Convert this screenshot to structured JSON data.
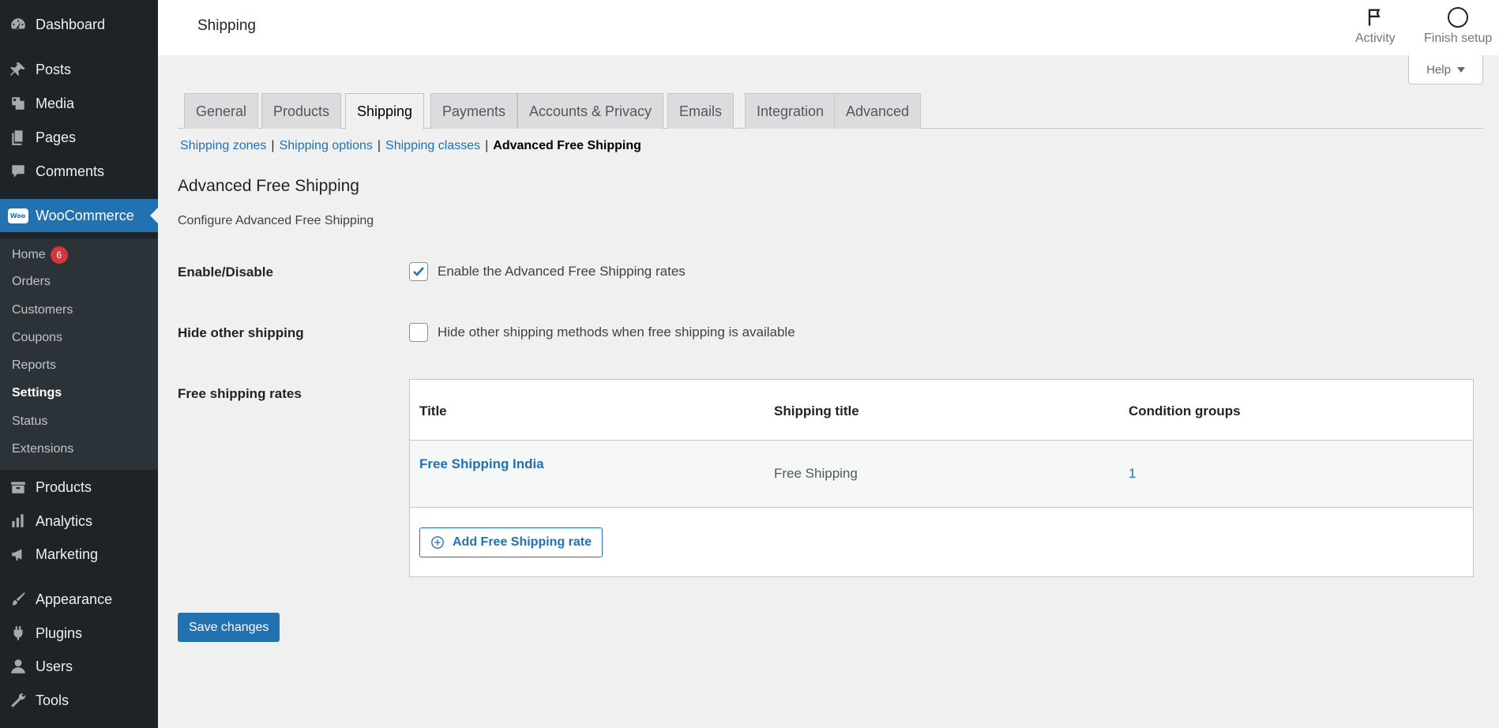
{
  "sidebar": {
    "top_items": [
      {
        "label": "Dashboard",
        "icon": "dashboard-icon"
      },
      {
        "label": "Posts",
        "icon": "pin-icon"
      },
      {
        "label": "Media",
        "icon": "media-icon"
      },
      {
        "label": "Pages",
        "icon": "pages-icon"
      },
      {
        "label": "Comments",
        "icon": "comment-icon"
      }
    ],
    "woocommerce": {
      "label": "WooCommerce",
      "logo_text": "Woo"
    },
    "submenu": [
      {
        "label": "Home",
        "badge": "6"
      },
      {
        "label": "Orders"
      },
      {
        "label": "Customers"
      },
      {
        "label": "Coupons"
      },
      {
        "label": "Reports"
      },
      {
        "label": "Settings",
        "active": true
      },
      {
        "label": "Status"
      },
      {
        "label": "Extensions"
      }
    ],
    "bottom_items": [
      {
        "label": "Products",
        "icon": "archive-icon"
      },
      {
        "label": "Analytics",
        "icon": "chart-icon"
      },
      {
        "label": "Marketing",
        "icon": "megaphone-icon"
      },
      {
        "label": "Appearance",
        "icon": "brush-icon"
      },
      {
        "label": "Plugins",
        "icon": "plugin-icon"
      },
      {
        "label": "Users",
        "icon": "user-icon"
      },
      {
        "label": "Tools",
        "icon": "wrench-icon"
      }
    ]
  },
  "topbar": {
    "title": "Shipping",
    "activity_label": "Activity",
    "finish_setup_label": "Finish setup",
    "help_label": "Help"
  },
  "tabs": [
    "General",
    "Products",
    "Shipping",
    "Payments",
    "Accounts & Privacy",
    "Emails",
    "Integration",
    "Advanced"
  ],
  "active_tab": "Shipping",
  "sublinks": {
    "shipping_zones": "Shipping zones",
    "shipping_options": "Shipping options",
    "shipping_classes": "Shipping classes",
    "current": "Advanced Free Shipping",
    "separator": "|"
  },
  "section": {
    "title": "Advanced Free Shipping",
    "description": "Configure Advanced Free Shipping"
  },
  "fields": {
    "enable": {
      "label": "Enable/Disable",
      "checkbox_label": "Enable the Advanced Free Shipping rates",
      "checked": true
    },
    "hide_other": {
      "label": "Hide other shipping",
      "checkbox_label": "Hide other shipping methods when free shipping is available",
      "checked": false
    },
    "rates": {
      "label": "Free shipping rates"
    }
  },
  "rates_table": {
    "headers": {
      "title": "Title",
      "shipping_title": "Shipping title",
      "condition_groups": "Condition groups"
    },
    "rows": [
      {
        "title": "Free Shipping India",
        "shipping_title": "Free Shipping",
        "condition_groups": "1"
      }
    ],
    "add_button_label": "Add Free Shipping rate"
  },
  "save_button_label": "Save changes",
  "colors": {
    "accent": "#2271b1",
    "sidebar": "#1d2327",
    "submenu": "#2c3338",
    "badge": "#d63638"
  }
}
